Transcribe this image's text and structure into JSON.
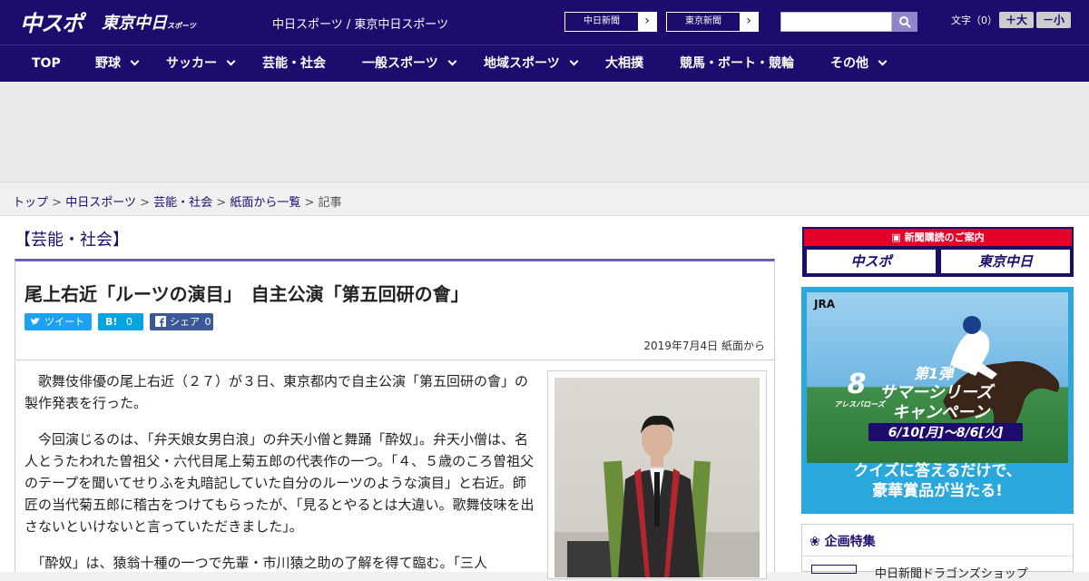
{
  "header": {
    "logo_chuspo": "中スポ",
    "logo_tokyo": "東京中日",
    "logo_tokyo_small": "スポーツ",
    "tagline": "中日スポーツ / 東京中日スポーツ",
    "site_links": [
      "中日新聞",
      "東京新聞"
    ],
    "search_placeholder": "",
    "font_size_label": "文字（0）",
    "font_larger": "＋大",
    "font_smaller": "－小"
  },
  "nav": {
    "items": [
      "TOP",
      "野球",
      "サッカー",
      "芸能・社会",
      "一般スポーツ",
      "地域スポーツ",
      "大相撲",
      "競馬・ボート・競輪",
      "その他"
    ]
  },
  "breadcrumb": {
    "items": [
      "トップ",
      "中日スポーツ",
      "芸能・社会",
      "紙面から一覧"
    ],
    "current": "記事",
    "separator": ">"
  },
  "article": {
    "category": "【芸能・社会】",
    "title": "尾上右近「ルーツの演目」　自主公演「第五回研の會」",
    "share": {
      "tweet_label": "ツイート",
      "hatena_label": "B!",
      "hatena_count": "0",
      "facebook_label": "シェア",
      "facebook_count": "0"
    },
    "date": "2019年7月4日 紙面から",
    "paragraphs": [
      "　歌舞伎俳優の尾上右近（２７）が３日、東京都内で自主公演「第五回研の會」の製作発表を行った。",
      "　今回演じるのは、「弁天娘女男白浪」の弁天小僧と舞踊「酔奴」。弁天小僧は、名人とうたわれた曽祖父・六代目尾上菊五郎の代表作の一つ。「４、５歳のころ曽祖父のテープを聞いてせりふを丸暗記していた自分のルーツのような演目」と右近。師匠の当代菊五郎に稽古をつけてもらったが、「見るとやるとは大違い。歌舞伎味を出さないといけないと言っていただきました」。",
      "　「酔奴」は、猿翁十種の一つで先輩・市川猿之助の了解を得て臨む。「三人"
    ]
  },
  "sidebar": {
    "subscribe_header": "新聞購読のご案内",
    "subscribe_logos": [
      "中スポ",
      "東京中日"
    ],
    "jra_ad": {
      "logo": "JRA",
      "campaign_number": "8",
      "campaign_sub": "アレスバローズ",
      "campaign_series": "第1弾",
      "campaign_title": "サマーシリーズ",
      "campaign_title2": "キャンペーン",
      "campaign_dates": "6/10[月]～8/6[火]",
      "quiz_line1": "クイズに答えるだけで、",
      "quiz_line2": "豪華賞品が当たる!"
    },
    "kikaku_title": "企画特集",
    "kikaku_item": "中日新聞ドラゴンズショップ"
  },
  "colors": {
    "brand": "#1d0b6e",
    "accent_red": "#e5002a",
    "twitter": "#1da1f2",
    "hatena": "#00a4de",
    "facebook": "#3b5998",
    "jra_blue": "#2aa7dd"
  }
}
